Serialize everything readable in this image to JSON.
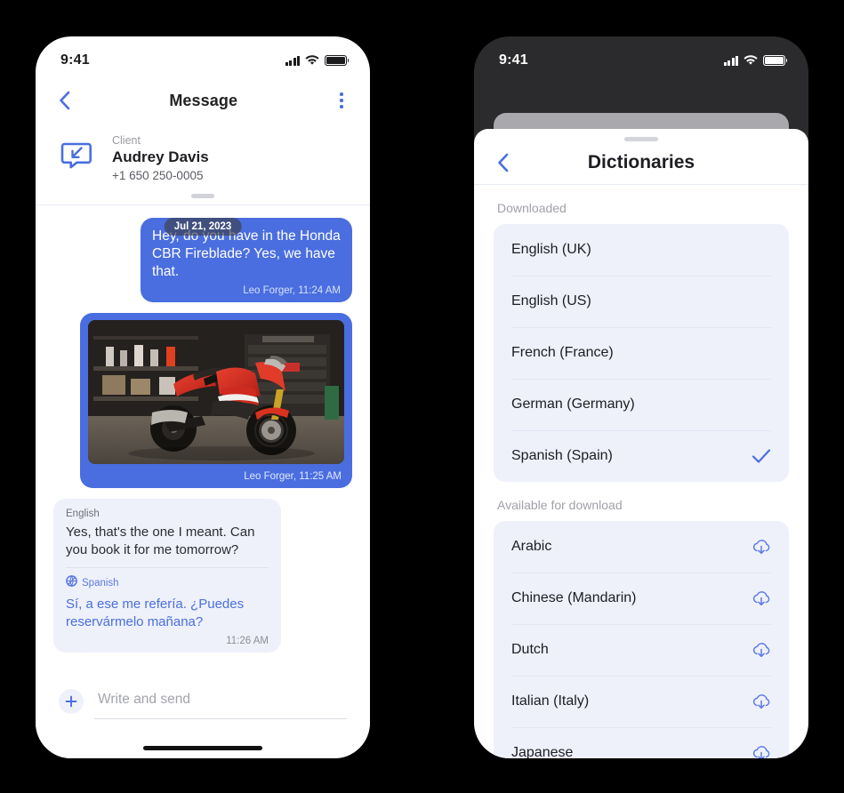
{
  "theme": {
    "accent": "#4a6ee0",
    "bubble_in_bg": "#eef1fa",
    "card_bg": "#eef1fa",
    "page_bg": "#000000",
    "muted_text": "#a0a1a9"
  },
  "left_phone": {
    "status": {
      "time": "9:41",
      "signal_icon": "signal-bars-icon",
      "wifi_icon": "wifi-icon",
      "battery_icon": "battery-icon"
    },
    "nav": {
      "back_icon": "chevron-left-icon",
      "title": "Message",
      "menu_icon": "kebab-menu-icon"
    },
    "contact": {
      "avatar_icon": "incoming-message-bubble-icon",
      "role": "Client",
      "name": "Audrey Davis",
      "phone": "+1 650 250-0005"
    },
    "chat": {
      "date_pill": "Jul 21, 2023",
      "messages": [
        {
          "type": "text",
          "side": "out",
          "text": "Hey, do you have in the Honda CBR Fireblade? Yes, we have that.",
          "meta": "Leo Forger, 11:24 AM"
        },
        {
          "type": "image",
          "side": "out",
          "image_alt": "Red Honda CBR Fireblade sportbike parked in a workshop garage",
          "meta": "Leo Forger, 11:25 AM"
        },
        {
          "type": "translated",
          "side": "in",
          "source_language": "English",
          "source_text": "Yes, that's the one I meant. Can you book it for me tomorrow?",
          "target_language": "Spanish",
          "target_language_icon": "translate-icon",
          "target_text": "Sí, a ese me refería. ¿Puedes reservármelo mañana?",
          "meta": "11:26 AM"
        }
      ]
    },
    "composer": {
      "add_icon": "plus-icon",
      "placeholder": "Write and send"
    }
  },
  "right_phone": {
    "status": {
      "time": "9:41",
      "signal_icon": "signal-bars-icon",
      "wifi_icon": "wifi-icon",
      "battery_icon": "battery-icon"
    },
    "sheet": {
      "grabber_icon": "sheet-grabber-icon",
      "back_icon": "chevron-left-icon",
      "title": "Dictionaries",
      "sections": [
        {
          "label": "Downloaded",
          "items": [
            {
              "name": "English (UK)",
              "state": "downloaded",
              "icon": ""
            },
            {
              "name": "English (US)",
              "state": "downloaded",
              "icon": ""
            },
            {
              "name": "French (France)",
              "state": "downloaded",
              "icon": ""
            },
            {
              "name": "German (Germany)",
              "state": "downloaded",
              "icon": ""
            },
            {
              "name": "Spanish (Spain)",
              "state": "selected",
              "icon": "checkmark-icon"
            }
          ]
        },
        {
          "label": "Available for download",
          "items": [
            {
              "name": "Arabic",
              "state": "available",
              "icon": "cloud-download-icon"
            },
            {
              "name": "Chinese (Mandarin)",
              "state": "available",
              "icon": "cloud-download-icon"
            },
            {
              "name": "Dutch",
              "state": "available",
              "icon": "cloud-download-icon"
            },
            {
              "name": "Italian (Italy)",
              "state": "available",
              "icon": "cloud-download-icon"
            },
            {
              "name": "Japanese",
              "state": "available",
              "icon": "cloud-download-icon"
            }
          ]
        }
      ]
    }
  }
}
